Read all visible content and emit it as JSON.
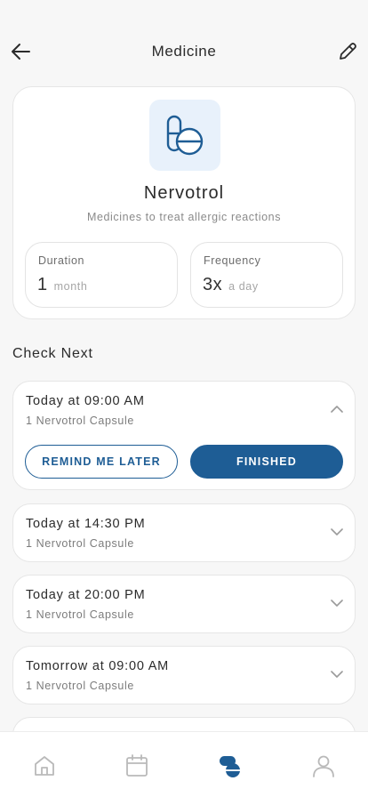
{
  "header": {
    "title": "Medicine"
  },
  "medicine": {
    "name": "Nervotrol",
    "description": "Medicines to treat allergic reactions",
    "duration": {
      "label": "Duration",
      "value": "1",
      "unit": "month"
    },
    "frequency": {
      "label": "Frequency",
      "value": "3x",
      "unit": "a day"
    }
  },
  "section": {
    "title": "Check Next"
  },
  "doses": [
    {
      "time": "Today at 09:00 AM",
      "detail": "1 Nervotrol Capsule",
      "expanded": true
    },
    {
      "time": "Today at 14:30 PM",
      "detail": "1 Nervotrol Capsule",
      "expanded": false
    },
    {
      "time": "Today at 20:00 PM",
      "detail": "1 Nervotrol Capsule",
      "expanded": false
    },
    {
      "time": "Tomorrow at 09:00 AM",
      "detail": "1 Nervotrol Capsule",
      "expanded": false
    }
  ],
  "actions": {
    "remind_label": "REMIND ME LATER",
    "finished_label": "FINISHED"
  },
  "nav": {
    "items": [
      "home-icon",
      "calendar-icon",
      "pill-icon",
      "profile-icon"
    ],
    "active": "pill-icon"
  },
  "colors": {
    "accent": "#1e5d95",
    "tile_bg": "#e8f1fb",
    "active_nav": "#1e5d95",
    "inactive_nav": "#b9b9b9"
  }
}
